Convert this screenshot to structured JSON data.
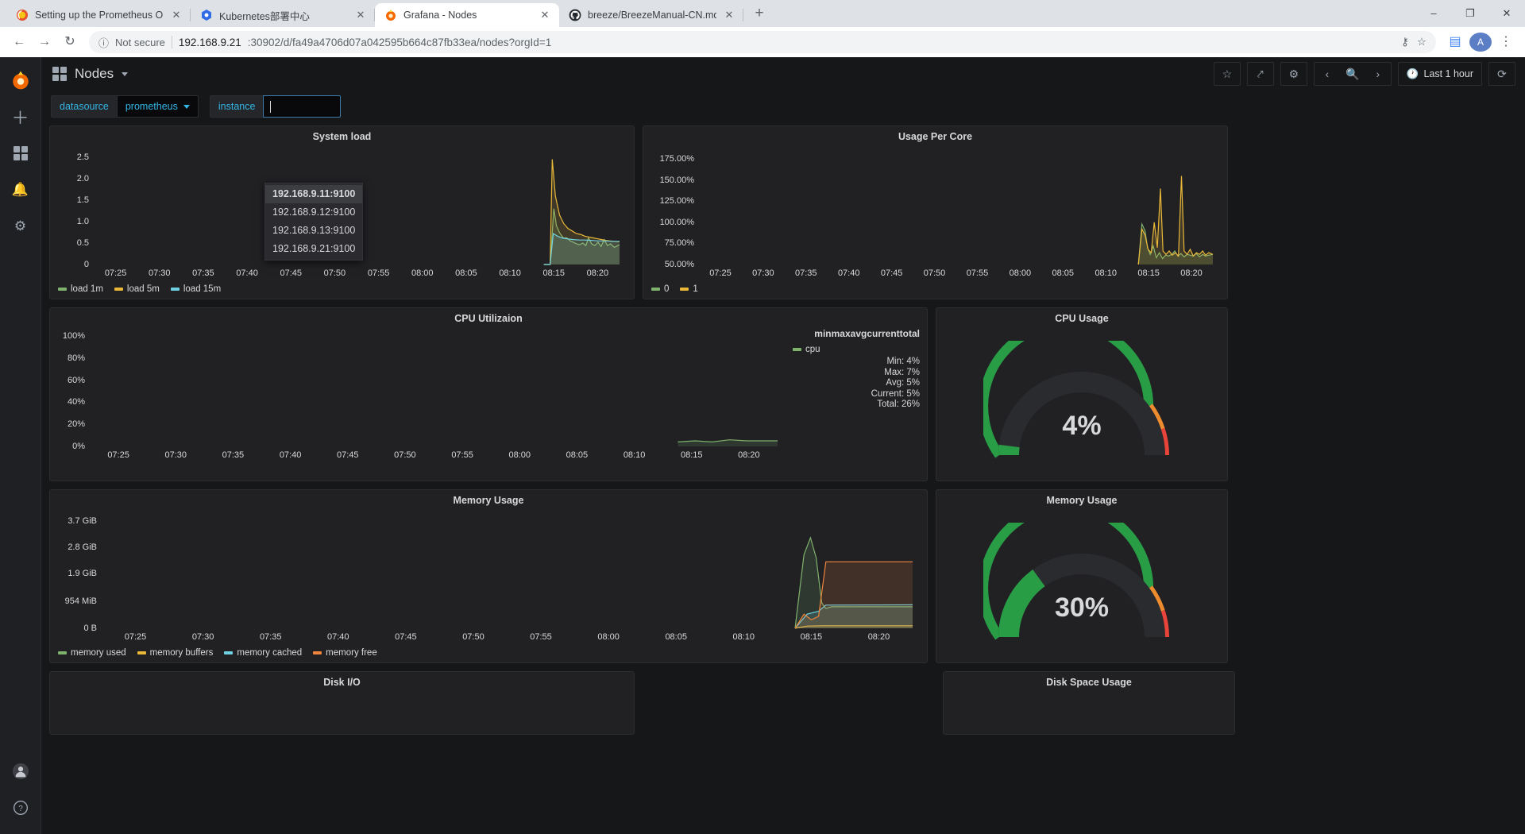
{
  "browser": {
    "tabs": [
      {
        "title": "Setting up the Prometheus Op",
        "favicon": "prometheus-icon",
        "active": false
      },
      {
        "title": "Kubernetes部署中心",
        "favicon": "kubernetes-icon",
        "active": false
      },
      {
        "title": "Grafana - Nodes",
        "favicon": "grafana-icon",
        "active": true
      },
      {
        "title": "breeze/BreezeManual-CN.md",
        "favicon": "github-icon",
        "active": false
      }
    ],
    "new_tab_label": "+",
    "window_controls": {
      "minimize": "–",
      "maximize": "❐",
      "close": "✕"
    },
    "nav": {
      "back": "←",
      "forward": "→",
      "reload": "↻"
    },
    "security_label": "Not secure",
    "url_host": "192.168.9.21",
    "url_rest": ":30902/d/fa49a4706d07a042595b664c87fb33ea/nodes?orgId=1",
    "omnibox_icons": [
      "key-icon",
      "star-icon",
      "extension-icon"
    ],
    "profile_initial": "A",
    "menu_icon": "kebab-menu-icon"
  },
  "grafana": {
    "sidebar_icons": [
      "grafana-logo-icon",
      "create-icon",
      "dashboards-icon",
      "alerting-icon",
      "configuration-icon",
      "user-avatar-icon",
      "help-icon"
    ],
    "dashboard_title": "Nodes",
    "toolbar_icons": [
      "star-icon",
      "share-icon",
      "settings-gear-icon",
      "time-range-back-icon",
      "zoom-out-icon",
      "time-range-forward-icon",
      "refresh-icon"
    ],
    "time_range": "Last 1 hour",
    "variables": [
      {
        "name": "datasource",
        "value": "prometheus",
        "type": "select"
      },
      {
        "name": "instance",
        "value": "",
        "type": "textbox",
        "placeholder": ""
      }
    ],
    "instance_dropdown": {
      "open": true,
      "options": [
        "192.168.9.11:9100",
        "192.168.9.12:9100",
        "192.168.9.13:9100",
        "192.168.9.21:9100"
      ],
      "selected_index": 0
    }
  },
  "chart_data": [
    {
      "id": "system-load",
      "type": "line",
      "title": "System load",
      "xlabel": "",
      "ylabel": "",
      "ylim": [
        0,
        2.7
      ],
      "yticks": [
        "0",
        "0.5",
        "1.0",
        "1.5",
        "2.0",
        "2.5"
      ],
      "ytick_values": [
        0,
        0.5,
        1.0,
        1.5,
        2.0,
        2.5
      ],
      "xticks": [
        "07:25",
        "07:30",
        "07:35",
        "07:40",
        "07:45",
        "07:50",
        "07:55",
        "08:00",
        "08:05",
        "08:10",
        "08:15",
        "08:20"
      ],
      "grid": true,
      "legend_position": "bottom",
      "series": [
        {
          "name": "load 1m",
          "color": "#7eb26d",
          "points": [
            [
              0.856,
              0
            ],
            [
              0.868,
              0.0
            ],
            [
              0.875,
              1.3
            ],
            [
              0.88,
              0.9
            ],
            [
              0.886,
              0.74
            ],
            [
              0.893,
              0.62
            ],
            [
              0.9,
              0.62
            ],
            [
              0.906,
              0.55
            ],
            [
              0.912,
              0.52
            ],
            [
              0.918,
              0.48
            ],
            [
              0.924,
              0.46
            ],
            [
              0.93,
              0.5
            ],
            [
              0.936,
              0.44
            ],
            [
              0.941,
              0.62
            ],
            [
              0.947,
              0.48
            ],
            [
              0.953,
              0.44
            ],
            [
              0.959,
              0.52
            ],
            [
              0.965,
              0.42
            ],
            [
              0.971,
              0.58
            ],
            [
              0.977,
              0.44
            ],
            [
              0.983,
              0.48
            ],
            [
              0.99,
              0.4
            ],
            [
              1.0,
              0.46
            ]
          ]
        },
        {
          "name": "load 5m",
          "color": "#eab839",
          "points": [
            [
              0.856,
              0
            ],
            [
              0.868,
              0.0
            ],
            [
              0.872,
              2.45
            ],
            [
              0.878,
              1.6
            ],
            [
              0.886,
              1.15
            ],
            [
              0.894,
              0.95
            ],
            [
              0.902,
              0.84
            ],
            [
              0.91,
              0.78
            ],
            [
              0.918,
              0.72
            ],
            [
              0.926,
              0.7
            ],
            [
              0.934,
              0.66
            ],
            [
              0.942,
              0.64
            ],
            [
              0.95,
              0.62
            ],
            [
              0.958,
              0.6
            ],
            [
              0.966,
              0.58
            ],
            [
              0.974,
              0.56
            ],
            [
              0.982,
              0.55
            ],
            [
              0.99,
              0.54
            ],
            [
              1.0,
              0.53
            ]
          ]
        },
        {
          "name": "load 15m",
          "color": "#6ed0e0",
          "points": [
            [
              0.856,
              0
            ],
            [
              0.868,
              0.0
            ],
            [
              0.874,
              0.72
            ],
            [
              0.882,
              0.66
            ],
            [
              0.89,
              0.62
            ],
            [
              0.9,
              0.6
            ],
            [
              0.912,
              0.58
            ],
            [
              0.924,
              0.57
            ],
            [
              0.936,
              0.57
            ],
            [
              0.948,
              0.56
            ],
            [
              0.96,
              0.55
            ],
            [
              0.972,
              0.55
            ],
            [
              0.986,
              0.54
            ],
            [
              1.0,
              0.54
            ]
          ]
        }
      ]
    },
    {
      "id": "usage-per-core",
      "type": "line",
      "title": "Usage Per Core",
      "ylim": [
        50,
        187.5
      ],
      "yticks": [
        "50.00%",
        "75.00%",
        "100.00%",
        "125.00%",
        "150.00%",
        "175.00%"
      ],
      "ytick_values": [
        50,
        75,
        100,
        125,
        150,
        175
      ],
      "xticks": [
        "07:25",
        "07:30",
        "07:35",
        "07:40",
        "07:45",
        "07:50",
        "07:55",
        "08:00",
        "08:05",
        "08:10",
        "08:15",
        "08:20"
      ],
      "grid": true,
      "legend_position": "bottom",
      "series": [
        {
          "name": "0",
          "color": "#7eb26d",
          "points": [
            [
              0.855,
              50
            ],
            [
              0.862,
              98
            ],
            [
              0.868,
              90
            ],
            [
              0.873,
              70
            ],
            [
              0.878,
              62
            ],
            [
              0.884,
              72
            ],
            [
              0.89,
              58
            ],
            [
              0.896,
              64
            ],
            [
              0.902,
              57
            ],
            [
              0.908,
              61
            ],
            [
              0.914,
              60
            ],
            [
              0.92,
              62
            ],
            [
              0.926,
              66
            ],
            [
              0.932,
              60
            ],
            [
              0.938,
              63
            ],
            [
              0.944,
              59
            ],
            [
              0.95,
              62
            ],
            [
              0.956,
              61
            ],
            [
              0.962,
              60
            ],
            [
              0.968,
              63
            ],
            [
              0.974,
              59
            ],
            [
              0.98,
              62
            ],
            [
              0.986,
              60
            ],
            [
              0.992,
              61
            ],
            [
              1.0,
              62
            ]
          ]
        },
        {
          "name": "1",
          "color": "#eab839",
          "points": [
            [
              0.855,
              50
            ],
            [
              0.862,
              92
            ],
            [
              0.868,
              85
            ],
            [
              0.874,
              68
            ],
            [
              0.88,
              64
            ],
            [
              0.886,
              100
            ],
            [
              0.892,
              70
            ],
            [
              0.898,
              140
            ],
            [
              0.903,
              66
            ],
            [
              0.909,
              62
            ],
            [
              0.915,
              66
            ],
            [
              0.921,
              61
            ],
            [
              0.927,
              64
            ],
            [
              0.933,
              60
            ],
            [
              0.939,
              155
            ],
            [
              0.944,
              66
            ],
            [
              0.95,
              62
            ],
            [
              0.956,
              68
            ],
            [
              0.962,
              60
            ],
            [
              0.968,
              64
            ],
            [
              0.974,
              62
            ],
            [
              0.98,
              66
            ],
            [
              0.986,
              61
            ],
            [
              0.992,
              64
            ],
            [
              1.0,
              62
            ]
          ]
        }
      ]
    },
    {
      "id": "cpu-utilizaion",
      "type": "line",
      "title": "CPU Utilizaion",
      "ylim": [
        0,
        105
      ],
      "yticks": [
        "0%",
        "20%",
        "40%",
        "60%",
        "80%",
        "100%"
      ],
      "ytick_values": [
        0,
        20,
        40,
        60,
        80,
        100
      ],
      "xticks": [
        "07:25",
        "07:30",
        "07:35",
        "07:40",
        "07:45",
        "07:50",
        "07:55",
        "08:00",
        "08:05",
        "08:10",
        "08:15",
        "08:20"
      ],
      "grid": true,
      "legend_position": "right",
      "legend_headers": [
        "min",
        "max",
        "avg",
        "current",
        "total"
      ],
      "legend_header_text": "minmaxavgcurrenttotal",
      "series": [
        {
          "name": "cpu",
          "color": "#7eb26d",
          "stats": {
            "Min": "4%",
            "Max": "7%",
            "Avg": "5%",
            "Current": "5%",
            "Total": "26%"
          },
          "points": [
            [
              0.855,
              4
            ],
            [
              0.88,
              5
            ],
            [
              0.905,
              4
            ],
            [
              0.93,
              6
            ],
            [
              0.955,
              5
            ],
            [
              0.98,
              5
            ],
            [
              1.0,
              5
            ]
          ]
        }
      ]
    },
    {
      "id": "cpu-usage-gauge",
      "type": "gauge",
      "title": "CPU Usage",
      "value": 4,
      "display": "4%",
      "min": 0,
      "max": 100,
      "thresholds": [
        {
          "from": 0,
          "to": 80,
          "color": "#299c46"
        },
        {
          "from": 80,
          "to": 90,
          "color": "#ed8b2f"
        },
        {
          "from": 90,
          "to": 100,
          "color": "#e8443a"
        }
      ]
    },
    {
      "id": "memory-usage",
      "type": "line",
      "title": "Memory Usage",
      "ylim": [
        0,
        4100
      ],
      "yticks": [
        "0 B",
        "954 MiB",
        "1.9 GiB",
        "2.8 GiB",
        "3.7 GiB"
      ],
      "ytick_values": [
        0,
        954,
        1946,
        2867,
        3789
      ],
      "xticks": [
        "07:25",
        "07:30",
        "07:35",
        "07:40",
        "07:45",
        "07:50",
        "07:55",
        "08:00",
        "08:05",
        "08:10",
        "08:15",
        "08:20"
      ],
      "grid": true,
      "legend_position": "bottom",
      "series": [
        {
          "name": "memory used",
          "color": "#7eb26d",
          "points": [
            [
              0.855,
              0
            ],
            [
              0.866,
              2600
            ],
            [
              0.874,
              3200
            ],
            [
              0.881,
              2500
            ],
            [
              0.888,
              900
            ],
            [
              0.893,
              700
            ],
            [
              0.9,
              760
            ],
            [
              1.0,
              760
            ]
          ]
        },
        {
          "name": "memory buffers",
          "color": "#eab839",
          "points": [
            [
              0.855,
              0
            ],
            [
              0.87,
              80
            ],
            [
              0.89,
              90
            ],
            [
              1.0,
              90
            ]
          ]
        },
        {
          "name": "memory cached",
          "color": "#6ed0e0",
          "points": [
            [
              0.855,
              0
            ],
            [
              0.87,
              500
            ],
            [
              0.884,
              600
            ],
            [
              0.893,
              820
            ],
            [
              1.0,
              830
            ]
          ]
        },
        {
          "name": "memory free",
          "color": "#ef843c",
          "points": [
            [
              0.855,
              0
            ],
            [
              0.866,
              500
            ],
            [
              0.875,
              300
            ],
            [
              0.884,
              420
            ],
            [
              0.893,
              2350
            ],
            [
              1.0,
              2350
            ]
          ]
        }
      ]
    },
    {
      "id": "memory-usage-gauge",
      "type": "gauge",
      "title": "Memory Usage",
      "value": 30,
      "display": "30%",
      "min": 0,
      "max": 100,
      "thresholds": [
        {
          "from": 0,
          "to": 80,
          "color": "#299c46"
        },
        {
          "from": 80,
          "to": 90,
          "color": "#ed8b2f"
        },
        {
          "from": 90,
          "to": 100,
          "color": "#e8443a"
        }
      ]
    },
    {
      "id": "disk-io",
      "type": "line",
      "title": "Disk I/O"
    },
    {
      "id": "disk-space-usage",
      "type": "gauge",
      "title": "Disk Space Usage"
    }
  ]
}
